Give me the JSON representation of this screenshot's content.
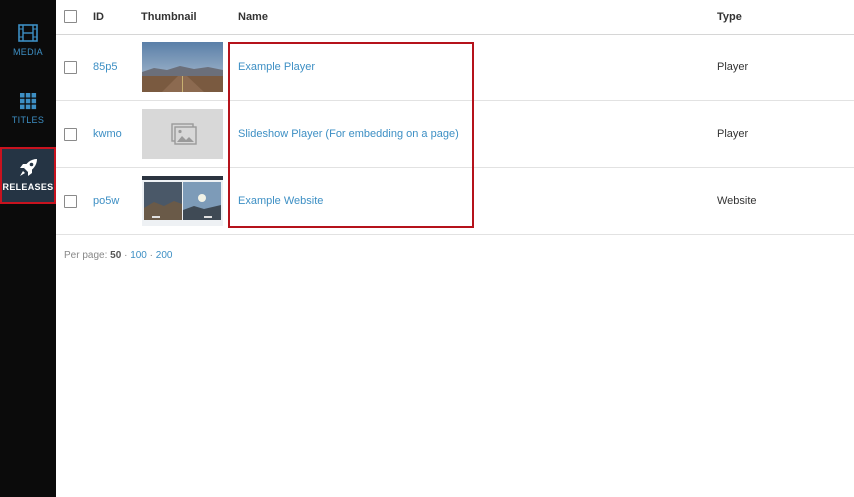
{
  "sidebar": {
    "items": [
      {
        "label": "MEDIA",
        "icon": "film-icon",
        "active": false
      },
      {
        "label": "TITLES",
        "icon": "grid-icon",
        "active": false
      },
      {
        "label": "RELEASES",
        "icon": "rocket-icon",
        "active": true
      }
    ]
  },
  "table": {
    "headers": {
      "id": "ID",
      "thumbnail": "Thumbnail",
      "name": "Name",
      "type": "Type"
    },
    "rows": [
      {
        "id": "85p5",
        "name": "Example Player",
        "type": "Player",
        "thumbnail": "desert-road-image"
      },
      {
        "id": "kwmo",
        "name": "Slideshow Player (For embedding on a page)",
        "type": "Player",
        "thumbnail": "image-placeholder-icon"
      },
      {
        "id": "po5w",
        "name": "Example Website",
        "type": "Website",
        "thumbnail": "website-preview-image"
      }
    ]
  },
  "pagination": {
    "label": "Per page:",
    "current": "50",
    "options": [
      "100",
      "200"
    ],
    "separator": "·"
  },
  "colors": {
    "sidebar_bg": "#0b0b0b",
    "active_bg": "#253444",
    "accent": "#3d8fc4",
    "highlight_red": "#b5121b"
  }
}
